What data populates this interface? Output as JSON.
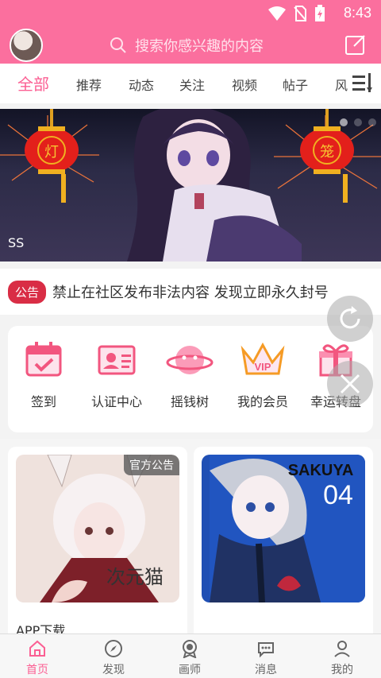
{
  "status_bar": {
    "time": "8:43"
  },
  "header": {
    "search_placeholder": "搜索你感兴趣的内容"
  },
  "tabs": [
    "全部",
    "推荐",
    "动态",
    "关注",
    "视频",
    "帖子",
    "风"
  ],
  "banner": {
    "label": "SS",
    "lantern_left": "灯",
    "lantern_right": "笼"
  },
  "notice": {
    "badge": "公告",
    "text": "禁止在社区发布非法内容 发现立即永久封号"
  },
  "features": [
    {
      "label": "签到",
      "icon": "calendar-check-icon"
    },
    {
      "label": "认证中心",
      "icon": "id-card-icon"
    },
    {
      "label": "摇钱树",
      "icon": "planet-icon"
    },
    {
      "label": "我的会员",
      "icon": "vip-crown-icon"
    },
    {
      "label": "幸运转盘",
      "icon": "gift-icon"
    }
  ],
  "posts": [
    {
      "badge": "官方公告",
      "title": "APP下载",
      "image_text": "次元猫"
    },
    {
      "badge": "",
      "title": "",
      "image_text": "SAKUYA",
      "image_number": "04"
    }
  ],
  "bottom_nav": [
    {
      "label": "首页",
      "icon": "home-icon"
    },
    {
      "label": "发现",
      "icon": "compass-icon"
    },
    {
      "label": "画师",
      "icon": "badge-icon"
    },
    {
      "label": "消息",
      "icon": "message-icon"
    },
    {
      "label": "我的",
      "icon": "user-icon"
    }
  ],
  "colors": {
    "brand_pink": "#fb6f9e",
    "notice_red": "#d92d45"
  }
}
